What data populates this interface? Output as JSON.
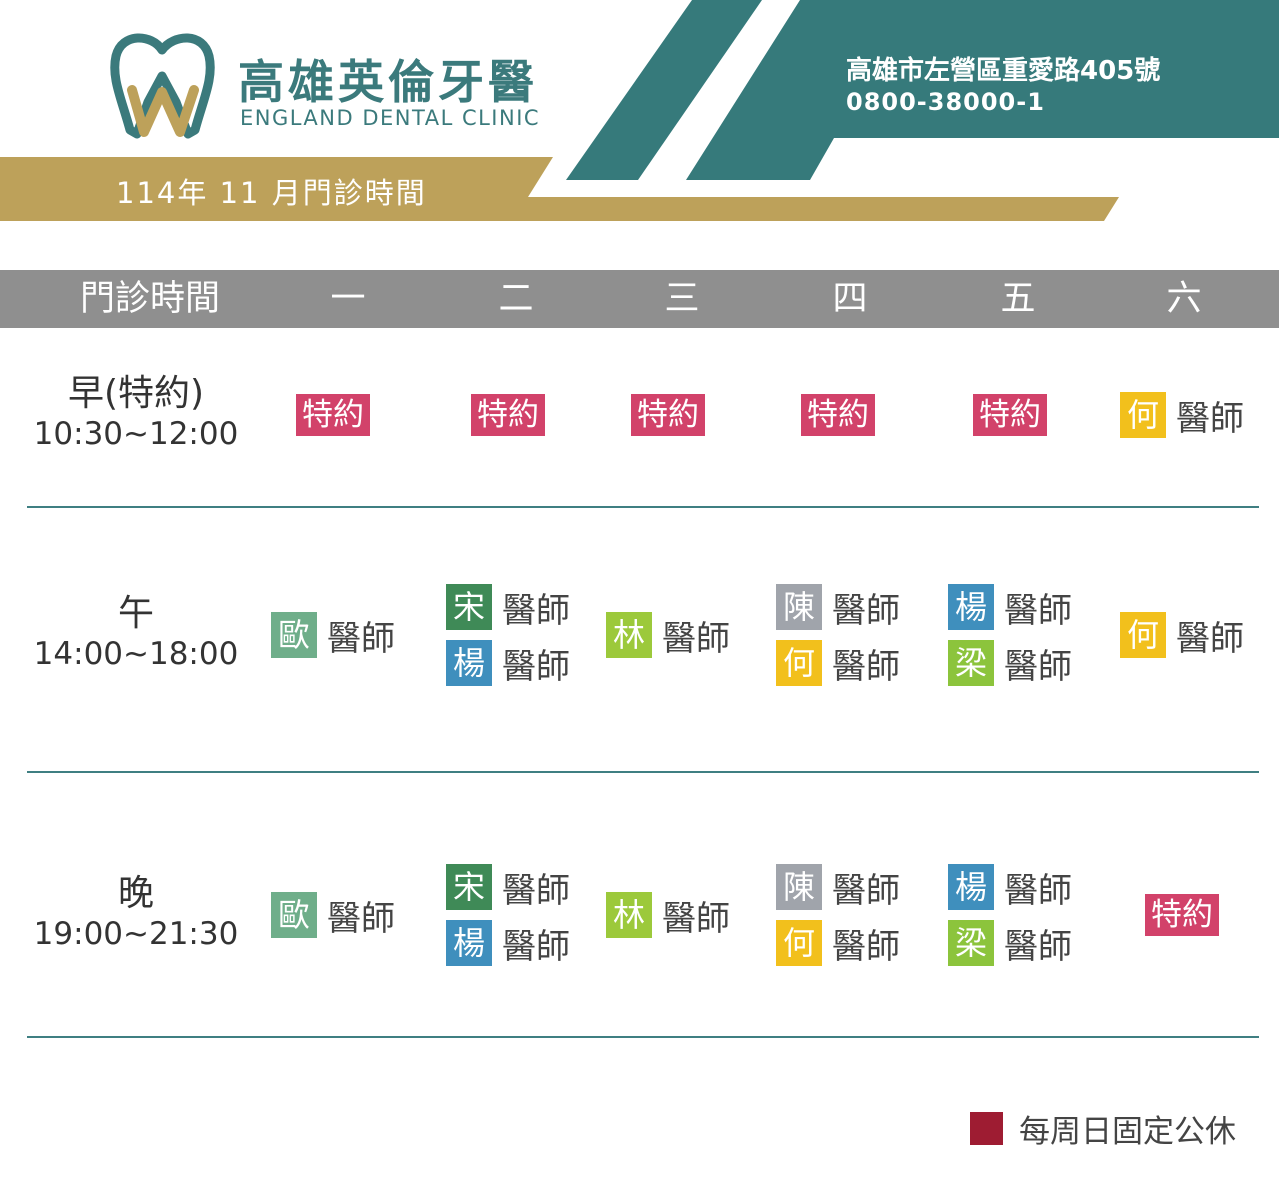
{
  "clinic": {
    "name_zh": "高雄英倫牙醫",
    "name_en": "ENGLAND DENTAL CLINIC",
    "address": "高雄市左營區重愛路405號",
    "phone": "0800-38000-1",
    "schedule_title": "114年 11 月門診時間"
  },
  "colors": {
    "teal": "#3b7a7c",
    "gold": "#bda15a",
    "header_gray": "#8f8f8f",
    "appointment_pink": "#d2426a",
    "holiday_red": "#9e1c32",
    "doctors": {
      "歐": "#6fae8a",
      "宋": "#3f8a57",
      "楊": "#3f8fbd",
      "林": "#9cc93b",
      "陳": "#a0a4ab",
      "何": "#f2c01c",
      "梁": "#8cc43c"
    }
  },
  "table": {
    "corner_header": "門診時間",
    "days": [
      "一",
      "二",
      "三",
      "四",
      "五",
      "六"
    ],
    "doctor_suffix": "醫師",
    "appointment_label": "特約",
    "rows": [
      {
        "name": "早(特約)",
        "time": "10:30~12:00",
        "cells": [
          [
            {
              "type": "appointment"
            }
          ],
          [
            {
              "type": "appointment"
            }
          ],
          [
            {
              "type": "appointment"
            }
          ],
          [
            {
              "type": "appointment"
            }
          ],
          [
            {
              "type": "appointment"
            }
          ],
          [
            {
              "type": "doctor",
              "name": "何"
            }
          ]
        ]
      },
      {
        "name": "午",
        "time": "14:00~18:00",
        "cells": [
          [
            {
              "type": "doctor",
              "name": "歐"
            }
          ],
          [
            {
              "type": "doctor",
              "name": "宋"
            },
            {
              "type": "doctor",
              "name": "楊"
            }
          ],
          [
            {
              "type": "doctor",
              "name": "林"
            }
          ],
          [
            {
              "type": "doctor",
              "name": "陳"
            },
            {
              "type": "doctor",
              "name": "何"
            }
          ],
          [
            {
              "type": "doctor",
              "name": "楊"
            },
            {
              "type": "doctor",
              "name": "梁"
            }
          ],
          [
            {
              "type": "doctor",
              "name": "何"
            }
          ]
        ]
      },
      {
        "name": "晚",
        "time": "19:00~21:30",
        "cells": [
          [
            {
              "type": "doctor",
              "name": "歐"
            }
          ],
          [
            {
              "type": "doctor",
              "name": "宋"
            },
            {
              "type": "doctor",
              "name": "楊"
            }
          ],
          [
            {
              "type": "doctor",
              "name": "林"
            }
          ],
          [
            {
              "type": "doctor",
              "name": "陳"
            },
            {
              "type": "doctor",
              "name": "何"
            }
          ],
          [
            {
              "type": "doctor",
              "name": "楊"
            },
            {
              "type": "doctor",
              "name": "梁"
            }
          ],
          [
            {
              "type": "appointment"
            }
          ]
        ]
      }
    ]
  },
  "legend": {
    "text": "每周日固定公休"
  }
}
